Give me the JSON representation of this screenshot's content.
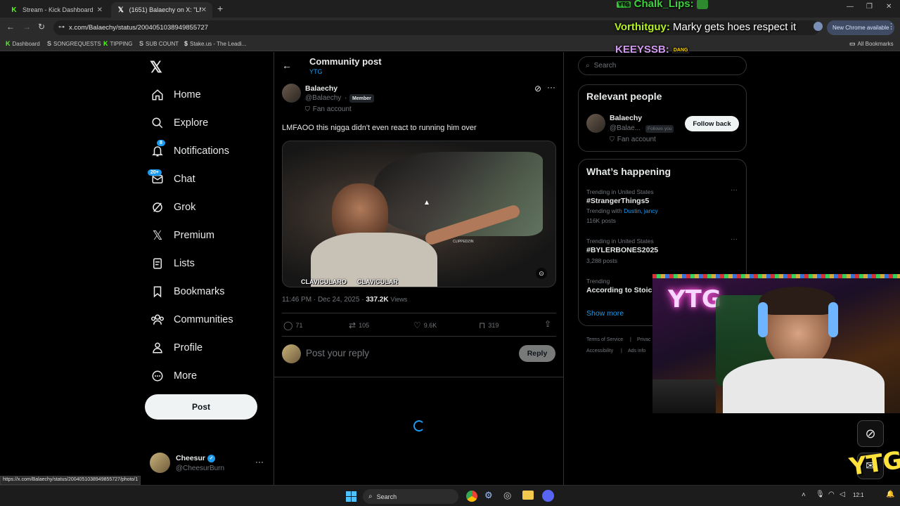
{
  "browser": {
    "tabs": [
      {
        "label": "Stream - Kick Dashboard",
        "icon": "kick-icon"
      },
      {
        "label": "(1651) Balaechy on X: \"LMFAO...",
        "icon": "x-logo-icon"
      }
    ],
    "url": "x.com/Balaechy/status/2004051038949855727",
    "new_chrome": "New Chrome available",
    "bookmarks": [
      "Dashboard",
      "SONGREQUESTS",
      "TIPPING",
      "SUB COUNT",
      "Stake.us - The Leadi..."
    ],
    "all_bookmarks": "All Bookmarks",
    "status_url": "https://x.com/Balaechy/status/2004051038949855727/photo/1"
  },
  "overlay_chat": [
    {
      "user": "Chalk_Lips:",
      "message": "",
      "user_color": "#3cd23c"
    },
    {
      "user": "Vorthitguy:",
      "message": "Marky gets hoes respect it",
      "user_color": "#b4f020"
    },
    {
      "user": "KEEYSSB:",
      "message": "DANG",
      "user_color": "#d29bf0"
    }
  ],
  "sidebar": {
    "items": [
      {
        "label": "Home",
        "icon": "home-icon"
      },
      {
        "label": "Explore",
        "icon": "search-icon"
      },
      {
        "label": "Notifications",
        "icon": "bell-icon",
        "badge": "8"
      },
      {
        "label": "Chat",
        "icon": "mail-icon",
        "badge": "20+"
      },
      {
        "label": "Grok",
        "icon": "grok-icon"
      },
      {
        "label": "Premium",
        "icon": "x-logo-icon"
      },
      {
        "label": "Lists",
        "icon": "list-icon"
      },
      {
        "label": "Bookmarks",
        "icon": "bookmark-icon"
      },
      {
        "label": "Communities",
        "icon": "people-icon"
      },
      {
        "label": "Profile",
        "icon": "person-icon"
      },
      {
        "label": "More",
        "icon": "more-circle-icon"
      }
    ],
    "post_button": "Post",
    "account": {
      "name": "Cheesur",
      "handle": "@CheesurBurn"
    }
  },
  "post": {
    "header_title": "Community post",
    "community": "YTG",
    "author_name": "Balaechy",
    "author_handle": "@Balaechy",
    "member_badge": "Member",
    "fan_account": "Fan account",
    "text": "LMFAOO this nigga didn't even react to running him over",
    "media_captions": {
      "left": "CLAVICULARO",
      "right": "CLAVICULAR",
      "watermark": "CLIPPEDZIN"
    },
    "time": "11:46 PM · Dec 24, 2025",
    "views": "337.2K",
    "views_label": "Views",
    "stats": {
      "replies": "71",
      "reposts": "105",
      "likes": "9.6K",
      "bookmarks": "319"
    },
    "reply_placeholder": "Post your reply",
    "reply_button": "Reply"
  },
  "right": {
    "search_placeholder": "Search",
    "relevant_title": "Relevant people",
    "relevant": {
      "name": "Balaechy",
      "handle": "@Balae...",
      "follows_you": "Follows you",
      "fan": "Fan account",
      "button": "Follow back"
    },
    "happening_title": "What’s happening",
    "trends": [
      {
        "meta": "Trending in United States",
        "title": "#StrangerThings5",
        "with_label": "Trending with",
        "with_links": "Dustin, jancy",
        "posts": "116K posts"
      },
      {
        "meta": "Trending in United States",
        "title": "#BYLERBONES2025",
        "posts": "3,288 posts"
      },
      {
        "meta": "Trending",
        "title": "According to Stoic"
      }
    ],
    "show_more": "Show more",
    "footer": [
      "Terms of Service",
      "Privac",
      "Accessibility",
      "Ads info"
    ]
  },
  "webcam": {
    "sign": "YTG",
    "logo": "YTG"
  },
  "taskbar": {
    "search": "Search",
    "time": "12:1"
  }
}
